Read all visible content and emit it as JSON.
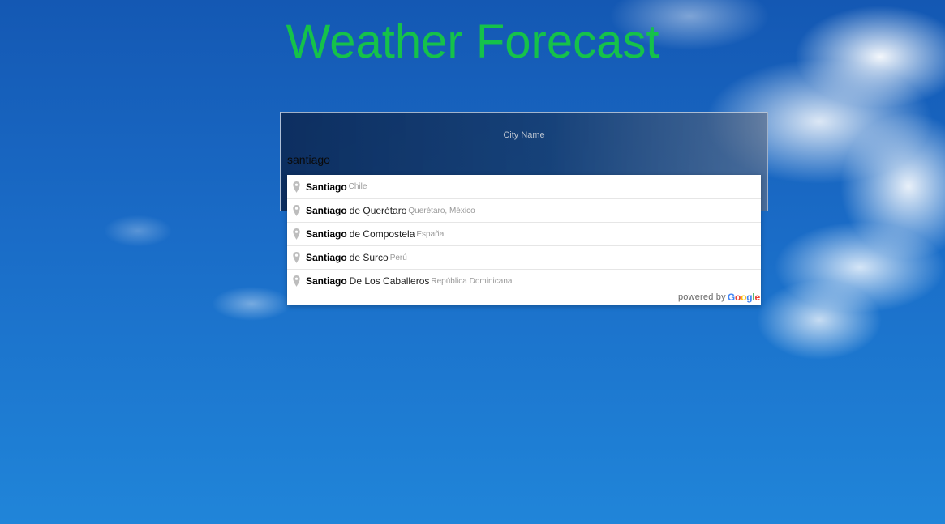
{
  "header": {
    "title": "Weather Forecast"
  },
  "form": {
    "label": "City Name",
    "value": "santiago"
  },
  "autocomplete": {
    "items": [
      {
        "match": "Santiago",
        "rest": "",
        "secondary": "Chile"
      },
      {
        "match": "Santiago",
        "rest": "de Querétaro",
        "secondary": "Querétaro, México"
      },
      {
        "match": "Santiago",
        "rest": "de Compostela",
        "secondary": "España"
      },
      {
        "match": "Santiago",
        "rest": "de Surco",
        "secondary": "Perú"
      },
      {
        "match": "Santiago",
        "rest": "De Los Caballeros",
        "secondary": "República Dominicana"
      }
    ],
    "powered_by": "powered by",
    "google": [
      "G",
      "o",
      "o",
      "g",
      "l",
      "e"
    ],
    "icon": "map-pin-icon"
  },
  "colors": {
    "title": "#15c24a",
    "google": [
      "#4285F4",
      "#EA4335",
      "#FBBC05",
      "#4285F4",
      "#34A853",
      "#EA4335"
    ]
  }
}
